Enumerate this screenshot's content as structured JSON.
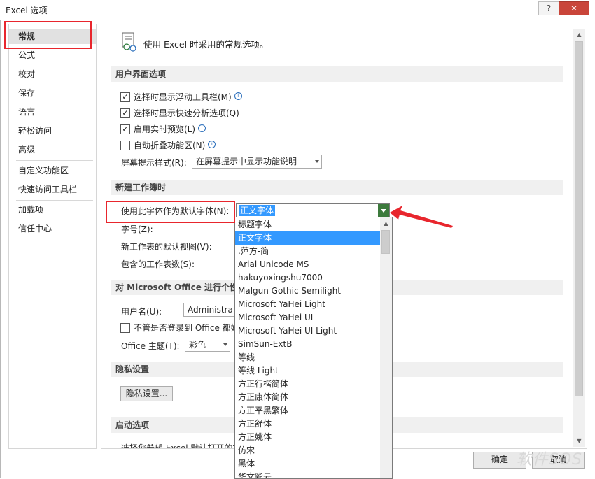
{
  "window": {
    "title": "Excel 选项",
    "help_label": "?",
    "close_label": "✕"
  },
  "nav": {
    "items": [
      {
        "label": "常规",
        "selected": true
      },
      {
        "label": "公式"
      },
      {
        "label": "校对"
      },
      {
        "label": "保存"
      },
      {
        "label": "语言"
      },
      {
        "label": "轻松访问"
      },
      {
        "label": "高级"
      },
      {
        "label": "自定义功能区"
      },
      {
        "label": "快速访问工具栏"
      },
      {
        "label": "加载项"
      },
      {
        "label": "信任中心"
      }
    ]
  },
  "main": {
    "intro": "使用 Excel 时采用的常规选项。",
    "ui_section": {
      "header": "用户界面选项",
      "options": [
        {
          "label": "选择时显示浮动工具栏(M)",
          "checked": true,
          "info": true
        },
        {
          "label": "选择时显示快速分析选项(Q)",
          "checked": true,
          "info": false
        },
        {
          "label": "启用实时预览(L)",
          "checked": true,
          "info": true
        },
        {
          "label": "自动折叠功能区(N)",
          "checked": false,
          "info": true
        }
      ],
      "screentip_label": "屏幕提示样式(R):",
      "screentip_value": "在屏幕提示中显示功能说明"
    },
    "workbook_section": {
      "header": "新建工作簿时",
      "font_label": "使用此字体作为默认字体(N):",
      "font_value": "正文字体",
      "size_label": "字号(Z):",
      "view_label": "新工作表的默认视图(V):",
      "sheets_label": "包含的工作表数(S):"
    },
    "office_section": {
      "header": "对 Microsoft Office 进行个性化",
      "username_label": "用户名(U):",
      "username_value": "Administrato",
      "always_label": "不管是否登录到 Office 都始",
      "theme_label": "Office 主题(T):",
      "theme_value": "彩色"
    },
    "privacy_section": {
      "header": "隐私设置",
      "button": "隐私设置..."
    },
    "startup_section": {
      "header": "启动选项",
      "text": "选择您希望 Excel 默认打开的扩"
    }
  },
  "font_dropdown": {
    "items": [
      "标题字体",
      "正文字体",
      ".萍方-简",
      "Arial Unicode MS",
      "hakuyoxingshu7000",
      "Malgun Gothic Semilight",
      "Microsoft YaHei Light",
      "Microsoft YaHei UI",
      "Microsoft YaHei UI Light",
      "SimSun-ExtB",
      "等线",
      "等线 Light",
      "方正行楷简体",
      "方正康体简体",
      "方正平黑繁体",
      "方正舒体",
      "方正姚体",
      "仿宋",
      "黑体",
      "华文彩云"
    ],
    "selected": "正文字体"
  },
  "footer": {
    "ok": "确定",
    "cancel": "取消"
  },
  "watermark": "软件SOS",
  "colors": {
    "annotation_red": "#e8262d",
    "selection_blue": "#3399ff"
  }
}
